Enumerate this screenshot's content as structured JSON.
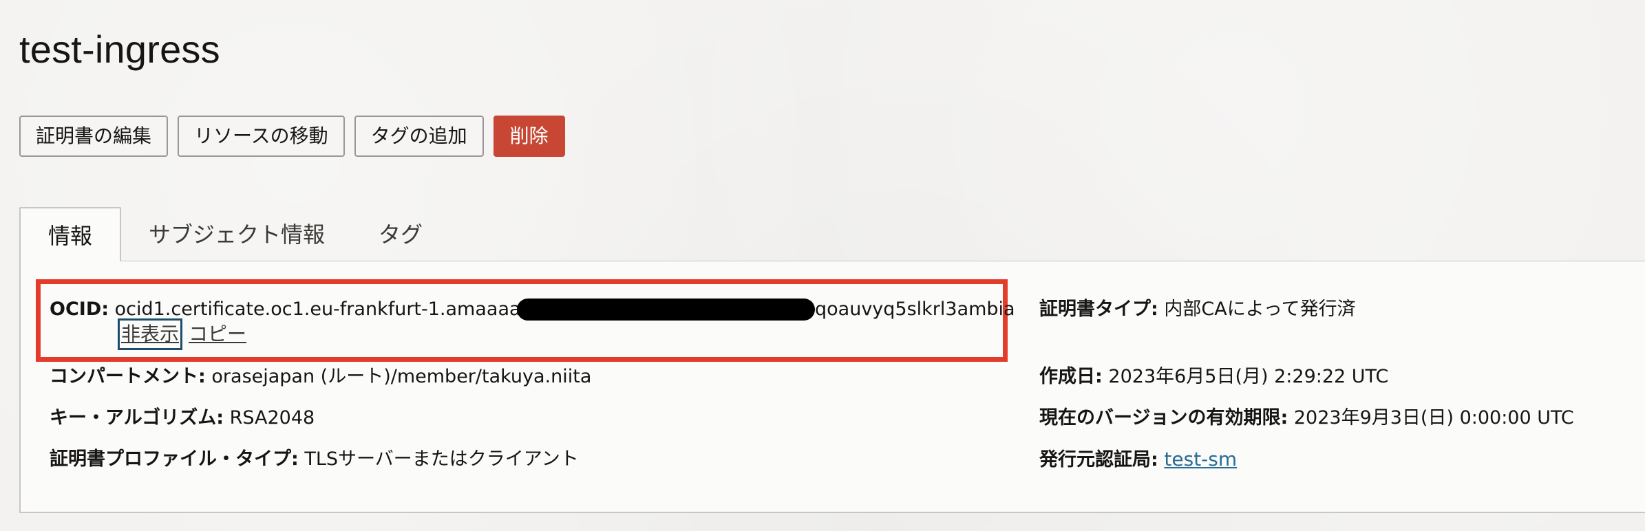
{
  "page": {
    "title": "test-ingress"
  },
  "actions": {
    "edit": "証明書の編集",
    "move": "リソースの移動",
    "add_tag": "タグの追加",
    "delete": "削除"
  },
  "tabs": [
    {
      "label": "情報",
      "active": true
    },
    {
      "label": "サブジェクト情報",
      "active": false
    },
    {
      "label": "タグ",
      "active": false
    }
  ],
  "info": {
    "ocid": {
      "label": "OCID:",
      "value_start": "ocid1.certificate.oc1.eu-frankfurt-1.amaaaaaas",
      "value_end": "qoauvyq5slkrl3ambia",
      "hide": "非表示",
      "copy": "コピー"
    },
    "compartment": {
      "label": "コンパートメント:",
      "value": "orasejapan (ルート)/member/takuya.niita"
    },
    "key_algorithm": {
      "label": "キー・アルゴリズム:",
      "value": "RSA2048"
    },
    "profile_type": {
      "label": "証明書プロファイル・タイプ:",
      "value": "TLSサーバーまたはクライアント"
    },
    "cert_type": {
      "label": "証明書タイプ:",
      "value": "内部CAによって発行済"
    },
    "created": {
      "label": "作成日:",
      "value": "2023年6月5日(月) 2:29:22 UTC"
    },
    "expiry": {
      "label": "現在のバージョンの有効期限:",
      "value": "2023年9月3日(日) 0:00:00 UTC"
    },
    "issuer": {
      "label": "発行元認証局:",
      "value": "test-sm"
    }
  },
  "colors": {
    "danger": "#c74634",
    "highlight": "#e33c2a",
    "link": "#2a6c94"
  }
}
